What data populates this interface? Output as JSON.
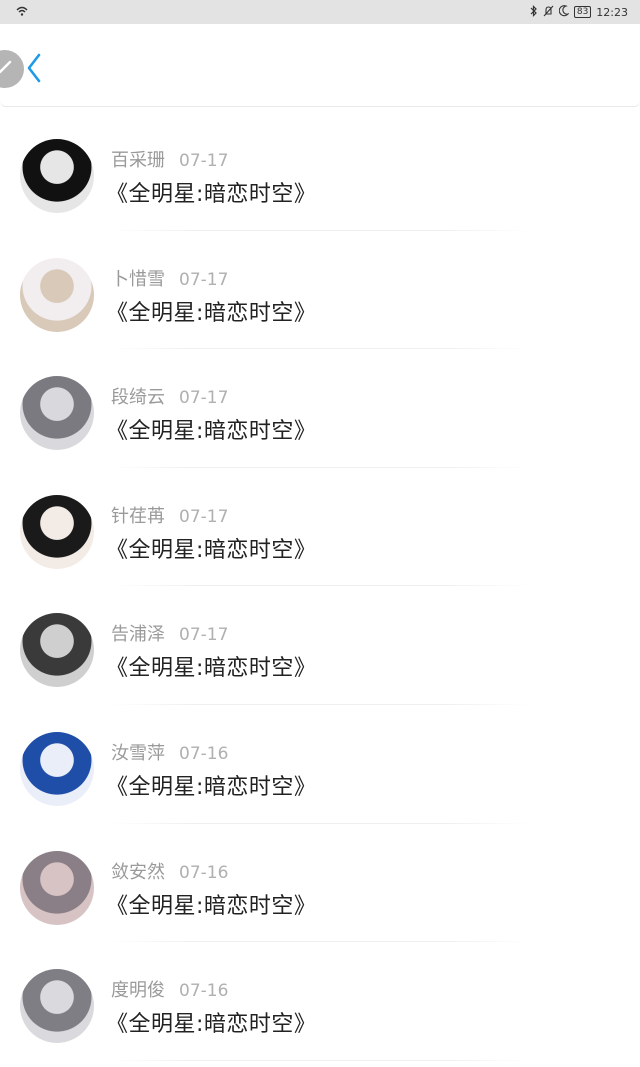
{
  "status": {
    "time": "12:23",
    "battery": "83"
  },
  "list": [
    {
      "name": "百采珊",
      "date": "07-17",
      "title": "《全明星:暗恋时空》",
      "avatar_colors": [
        "#111111",
        "#e6e6e6"
      ]
    },
    {
      "name": "卜惜雪",
      "date": "07-17",
      "title": "《全明星:暗恋时空》",
      "avatar_colors": [
        "#f2eef0",
        "#d8c9b8"
      ]
    },
    {
      "name": "段绮云",
      "date": "07-17",
      "title": "《全明星:暗恋时空》",
      "avatar_colors": [
        "#7a7a80",
        "#d9d9dd"
      ]
    },
    {
      "name": "针荏苒",
      "date": "07-17",
      "title": "《全明星:暗恋时空》",
      "avatar_colors": [
        "#1a1a1a",
        "#f3ece6"
      ]
    },
    {
      "name": "告浦泽",
      "date": "07-17",
      "title": "《全明星:暗恋时空》",
      "avatar_colors": [
        "#3a3a3a",
        "#cfcfcf"
      ]
    },
    {
      "name": "汝雪萍",
      "date": "07-16",
      "title": "《全明星:暗恋时空》",
      "avatar_colors": [
        "#1f4ea8",
        "#e9eef8"
      ]
    },
    {
      "name": "敛安然",
      "date": "07-16",
      "title": "《全明星:暗恋时空》",
      "avatar_colors": [
        "#8a7f86",
        "#d7c3c4"
      ]
    },
    {
      "name": "度明俊",
      "date": "07-16",
      "title": "《全明星:暗恋时空》",
      "avatar_colors": [
        "#7e7e84",
        "#d9d9de"
      ]
    }
  ],
  "icons": {
    "wifi": "wifi-icon",
    "bluetooth": "bluetooth-icon",
    "mute": "mute-icon",
    "moon": "moon-icon",
    "back": "back-chevron-icon",
    "edit": "pencil-icon"
  },
  "colors": {
    "accent": "#1d9be8",
    "name": "#9a9a9a",
    "title": "#222222"
  }
}
